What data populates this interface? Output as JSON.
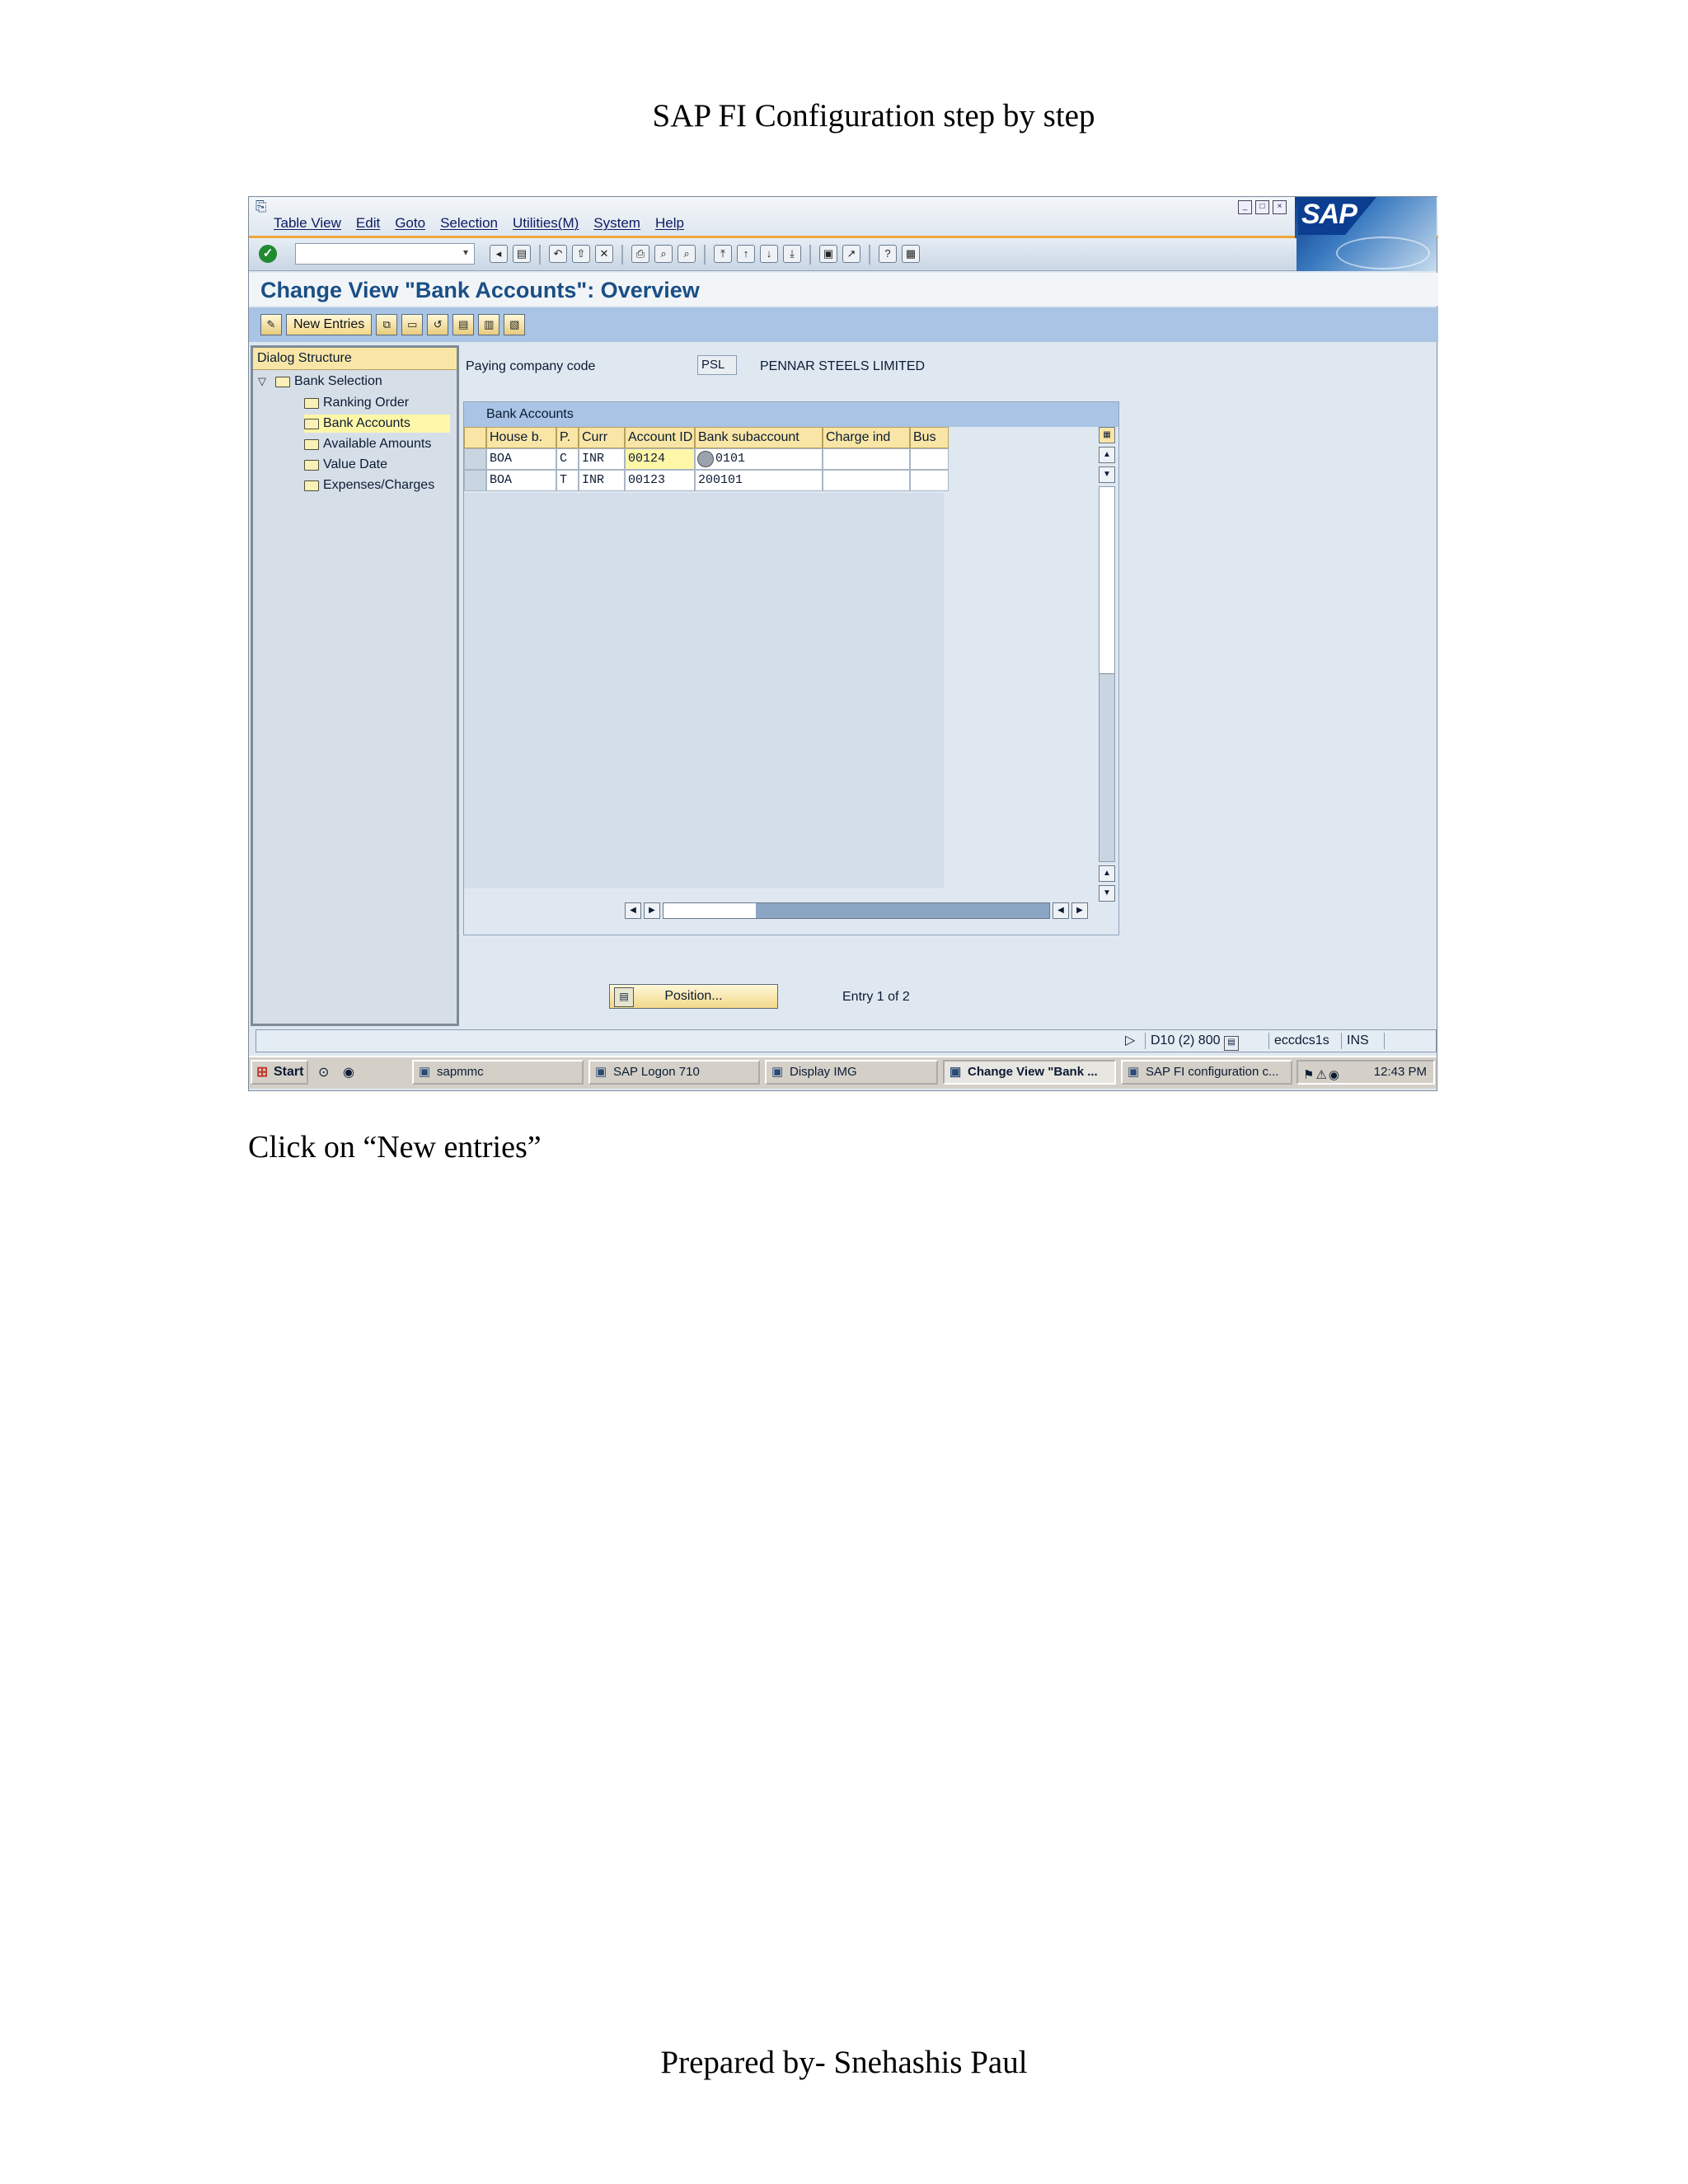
{
  "doc": {
    "title": "SAP FI Configuration step by step",
    "caption": "Click on “New entries”",
    "footer": "Prepared by- Snehashis Paul"
  },
  "menu": [
    "Table View",
    "Edit",
    "Goto",
    "Selection",
    "Utilities(M)",
    "System",
    "Help"
  ],
  "window_title": "Change View \"Bank Accounts\": Overview",
  "app_toolbar": {
    "new_entries": "New Entries"
  },
  "logo": "SAP",
  "tree": {
    "header": "Dialog Structure",
    "items": [
      "Bank Selection",
      "Ranking Order",
      "Bank Accounts",
      "Available Amounts",
      "Value Date",
      "Expenses/Charges"
    ],
    "selected": "Bank Accounts"
  },
  "company": {
    "label": "Paying company code",
    "code": "PSL",
    "name": "PENNAR STEELS LIMITED"
  },
  "table": {
    "title": "Bank Accounts",
    "columns": [
      "House b.",
      "P.",
      "Curr",
      "Account ID",
      "Bank subaccount",
      "Charge ind",
      "Bus"
    ],
    "rows": [
      [
        "BOA",
        "C",
        "INR",
        "00124",
        "0101",
        "",
        ""
      ],
      [
        "BOA",
        "T",
        "INR",
        "00123",
        "200101",
        "",
        ""
      ]
    ]
  },
  "position_button": "Position...",
  "entry_info": "Entry 1 of 2",
  "status": {
    "system": "D10 (2) 800",
    "server": "eccdcs1s",
    "mode": "INS"
  },
  "taskbar": {
    "start": "Start",
    "tasks": [
      "sapmmc",
      "SAP Logon 710",
      "Display IMG",
      "Change View \"Bank ...",
      "SAP FI configuration c..."
    ],
    "active_task": "Change View \"Bank ...",
    "time": "12:43 PM"
  }
}
